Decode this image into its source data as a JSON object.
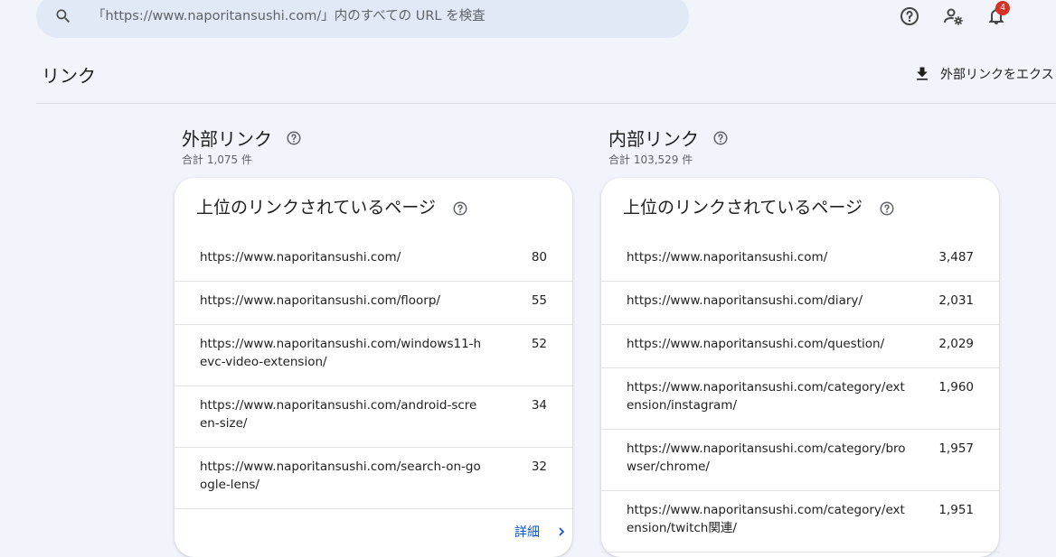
{
  "search": {
    "placeholder": "「https://www.naporitansushi.com/」内のすべての URL を検査"
  },
  "topbar": {
    "icons": [
      "help-icon",
      "manage-users-icon",
      "notifications-icon"
    ],
    "notification_count": "4"
  },
  "page": {
    "title": "リンク",
    "export_label": "外部リンクをエクス"
  },
  "external": {
    "title": "外部リンク",
    "total": "合計 1,075 件",
    "card_title": "上位のリンクされているページ",
    "rows": [
      {
        "url": "https://www.naporitansushi.com/",
        "value": "80"
      },
      {
        "url": "https://www.naporitansushi.com/floorp/",
        "value": "55"
      },
      {
        "url": "https://www.naporitansushi.com/windows11-hevc-video-extension/",
        "value": "52"
      },
      {
        "url": "https://www.naporitansushi.com/android-screen-size/",
        "value": "34"
      },
      {
        "url": "https://www.naporitansushi.com/search-on-google-lens/",
        "value": "32"
      }
    ],
    "detail_label": "詳細"
  },
  "internal": {
    "title": "内部リンク",
    "total": "合計 103,529 件",
    "card_title": "上位のリンクされているページ",
    "rows": [
      {
        "url": "https://www.naporitansushi.com/",
        "value": "3,487"
      },
      {
        "url": "https://www.naporitansushi.com/diary/",
        "value": "2,031"
      },
      {
        "url": "https://www.naporitansushi.com/question/",
        "value": "2,029"
      },
      {
        "url": "https://www.naporitansushi.com/category/extension/instagram/",
        "value": "1,960"
      },
      {
        "url": "https://www.naporitansushi.com/category/browser/chrome/",
        "value": "1,957"
      },
      {
        "url": "https://www.naporitansushi.com/category/extension/twitch関連/",
        "value": "1,951"
      }
    ]
  },
  "colors": {
    "background": "#f1f4fa",
    "search_bg": "#e1e9f6",
    "link_blue": "#0b57d0",
    "badge_red": "#d93025"
  }
}
